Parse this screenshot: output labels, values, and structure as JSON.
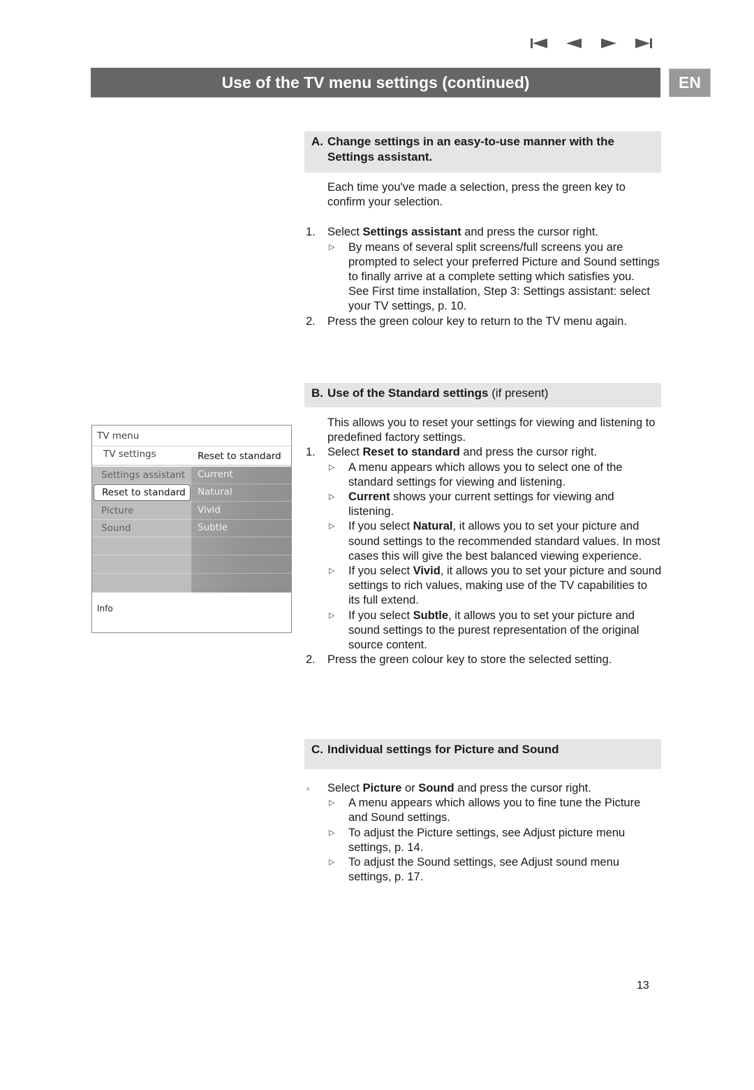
{
  "nav": {
    "icons": [
      "skip-to-first-icon",
      "previous-icon",
      "next-icon",
      "skip-to-last-icon"
    ]
  },
  "header": {
    "title": "Use of the TV menu settings  (continued)",
    "lang_badge": "EN"
  },
  "tv_menu": {
    "title": "TV menu",
    "submenu": "TV settings",
    "right_title": "Reset to standard",
    "left_items": [
      "Settings assistant",
      "Reset to standard",
      "Picture",
      "Sound",
      "",
      "",
      ""
    ],
    "selected_index": 1,
    "right_items": [
      "Current",
      "Natural",
      "Vivid",
      "Subtle",
      "",
      "",
      ""
    ],
    "info_label": "Info"
  },
  "section_a": {
    "letter": "A.",
    "heading": "Change settings in an easy-to-use manner with the Settings assistant.",
    "intro": "Each time you've made a selection, press the green key to confirm your selection.",
    "step1_num": "1.",
    "step1_pre": "Select ",
    "step1_bold": "Settings assistant",
    "step1_post": " and press the cursor right.",
    "step1_sub": "By means of several split screens/full screens you are prompted to select your preferred Picture and Sound settings to finally arrive at a complete setting which satisfies you.",
    "step1_sub2": "See First time installation, Step 3: Settings assistant: select your TV settings, p. 10.",
    "step2_num": "2.",
    "step2": "Press the green colour key to return to the TV menu again."
  },
  "section_b": {
    "letter": "B.",
    "heading_bold": "Use of the Standard settings",
    "heading_normal": " (if present)",
    "intro": "This allows you to reset your settings for viewing and listening to predefined factory settings.",
    "step1_num": "1.",
    "step1_pre": "Select ",
    "step1_bold": "Reset to standard",
    "step1_post": " and press the cursor right.",
    "subs": [
      {
        "pre": "A menu appears which allows you to select one of the standard settings for viewing and listening.",
        "bold": "",
        "post": ""
      },
      {
        "pre": "",
        "bold": "Current",
        "post": " shows your current settings for viewing and listening."
      },
      {
        "pre": "If you select ",
        "bold": "Natural",
        "post": ", it allows you to set your picture and sound settings to the recommended standard values. In most cases this will give the best balanced viewing experience."
      },
      {
        "pre": "If you select ",
        "bold": "Vivid",
        "post": ", it allows you to set your picture and sound settings to rich values, making use of the TV capabilities to its full extend."
      },
      {
        "pre": "If you select ",
        "bold": "Subtle",
        "post": ", it allows you to set your picture and sound settings to the purest representation of the original source content."
      }
    ],
    "step2_num": "2.",
    "step2": "Press the green colour key to store the selected setting."
  },
  "section_c": {
    "letter": "C.",
    "heading": "Individual settings for Picture and Sound",
    "bullet": "◦",
    "step_pre": "Select ",
    "step_bold1": "Picture",
    "step_mid": " or ",
    "step_bold2": "Sound",
    "step_post": " and press the cursor right.",
    "subs": [
      "A menu appears which allows you to fine tune the Picture and Sound settings.",
      "To adjust the Picture settings, see Adjust picture menu settings, p. 14.",
      "To adjust the Sound settings, see Adjust sound menu settings, p. 17."
    ]
  },
  "arrow_glyph": "▷",
  "page_number": "13",
  "colors": {
    "title_bar": "#666666",
    "lang_badge": "#999999",
    "section_head_bg": "#e5e5e5",
    "nav_icon": "#555555"
  }
}
